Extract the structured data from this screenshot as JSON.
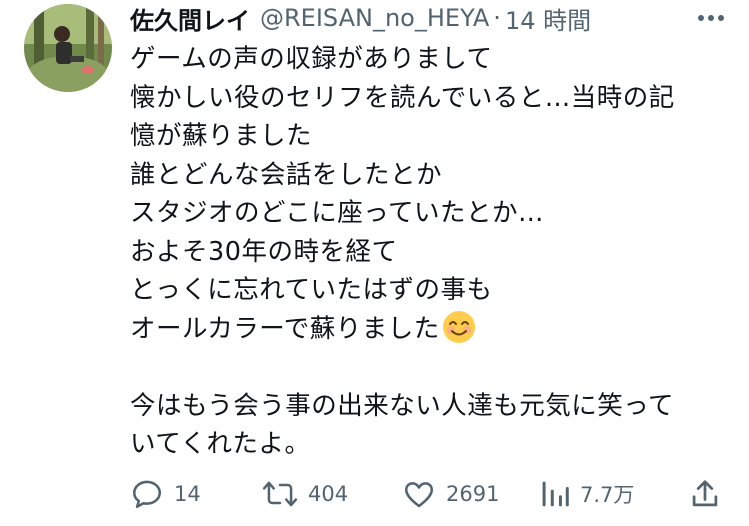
{
  "tweet": {
    "display_name": "佐久間レイ",
    "handle": "@REISAN_no_HEYA",
    "separator": "·",
    "time": "14 時間",
    "lines": [
      "ゲームの声の収録がありまして",
      "懐かしい役のセリフを読んでいると…当時の記",
      "憶が蘇りました",
      "誰とどんな会話をしたとか",
      "スタジオのどこに座っていたとか…",
      "およそ30年の時を経て",
      "とっくに忘れていたはずの事も",
      "オールカラーで蘇りました"
    ],
    "lines_after": [
      "今はもう会う事の出来ない人達も元気に笑って",
      "いてくれたよ。"
    ],
    "emoji": "smiling-face-emoji"
  },
  "actions": {
    "reply_count": "14",
    "retweet_count": "404",
    "like_count": "2691",
    "view_count": "7.7万"
  },
  "colors": {
    "text": "#0f1419",
    "secondary": "#536471",
    "background": "#ffffff"
  },
  "icons": {
    "reply": "reply-icon",
    "retweet": "retweet-icon",
    "like": "heart-icon",
    "views": "views-icon",
    "share": "share-icon",
    "more": "more-icon"
  }
}
